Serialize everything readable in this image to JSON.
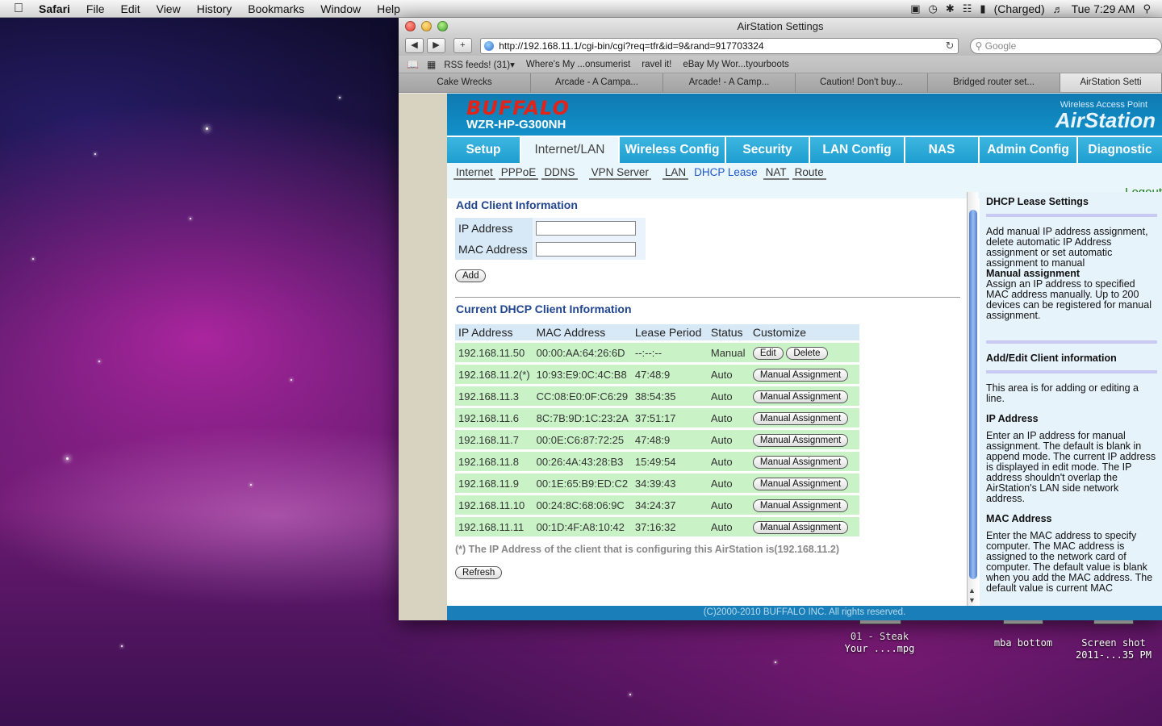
{
  "menubar": {
    "app": "Safari",
    "items": [
      "File",
      "Edit",
      "View",
      "History",
      "Bookmarks",
      "Window",
      "Help"
    ],
    "battery": "(Charged)",
    "clock": "Tue 7:29 AM"
  },
  "window": {
    "title": "AirStation Settings",
    "url": "http://192.168.11.1/cgi-bin/cgi?req=tfr&id=9&rand=917703324",
    "search_placeholder": "Google",
    "bookmarks": [
      "RSS feeds! (31)▾",
      "Where's My ...onsumerist",
      "ravel it!",
      "eBay My Wor...tyourboots"
    ],
    "tabs": [
      "Cake Wrecks",
      "Arcade - A Campa...",
      "Arcade! - A Camp...",
      "Caution! Don't buy...",
      "Bridged router set...",
      "AirStation Setti"
    ]
  },
  "router": {
    "brand": "BUFFALO",
    "model": "WZR-HP-G300NH",
    "ap_label": "Wireless Access Point",
    "ap_brand": "AirStation",
    "nav": [
      "Setup",
      "Internet/LAN",
      "Wireless Config",
      "Security",
      "LAN Config",
      "NAS",
      "Admin Config",
      "Diagnostic"
    ],
    "subnav": [
      "Internet",
      "PPPoE",
      "DDNS",
      "VPN Server",
      "LAN",
      "DHCP Lease",
      "NAT",
      "Route"
    ],
    "logout": "Logout",
    "add": {
      "title": "Add Client Information",
      "ip_label": "IP Address",
      "mac_label": "MAC Address",
      "ip_value": "",
      "mac_value": "",
      "add_button": "Add"
    },
    "current": {
      "title": "Current DHCP Client Information",
      "headers": [
        "IP Address",
        "MAC Address",
        "Lease Period",
        "Status",
        "Customize"
      ],
      "rows": [
        {
          "ip": "192.168.11.50",
          "mac": "00:00:AA:64:26:6D",
          "lease": "--:--:--",
          "status": "Manual"
        },
        {
          "ip": "192.168.11.2(*)",
          "mac": "10:93:E9:0C:4C:B8",
          "lease": "47:48:9",
          "status": "Auto"
        },
        {
          "ip": "192.168.11.3",
          "mac": "CC:08:E0:0F:C6:29",
          "lease": "38:54:35",
          "status": "Auto"
        },
        {
          "ip": "192.168.11.6",
          "mac": "8C:7B:9D:1C:23:2A",
          "lease": "37:51:17",
          "status": "Auto"
        },
        {
          "ip": "192.168.11.7",
          "mac": "00:0E:C6:87:72:25",
          "lease": "47:48:9",
          "status": "Auto"
        },
        {
          "ip": "192.168.11.8",
          "mac": "00:26:4A:43:28:B3",
          "lease": "15:49:54",
          "status": "Auto"
        },
        {
          "ip": "192.168.11.9",
          "mac": "00:1E:65:B9:ED:C2",
          "lease": "34:39:43",
          "status": "Auto"
        },
        {
          "ip": "192.168.11.10",
          "mac": "00:24:8C:68:06:9C",
          "lease": "34:24:37",
          "status": "Auto"
        },
        {
          "ip": "192.168.11.11",
          "mac": "00:1D:4F:A8:10:42",
          "lease": "37:16:32",
          "status": "Auto"
        }
      ],
      "edit_button": "Edit",
      "delete_button": "Delete",
      "manual_button": "Manual Assignment",
      "note": "(*) The IP Address of the client that is configuring this AirStation is(192.168.11.2)",
      "refresh_button": "Refresh"
    },
    "help": {
      "h1": "DHCP Lease Settings",
      "p1": "Add manual IP address assignment, delete automatic IP Address assignment or set automatic assignment to manual",
      "p1_bold": "Manual assignment",
      "p1_tail": "Assign an IP address to specified MAC address manually. Up to 200 devices can be registered for manual assignment.",
      "h2": "Add/Edit Client information",
      "p2": "This area is for adding or editing a line.",
      "h3": "IP Address",
      "p3": "Enter an IP address for manual assignment. The default is blank in append mode. The current IP address is displayed in edit mode. The IP address shouldn't overlap the AirStation's LAN side network address.",
      "h4": "MAC Address",
      "p4": "Enter the MAC address to specify computer. The MAC address is assigned to the network card of computer. The default value is blank when you add the MAC address. The default value is current MAC"
    },
    "footer": "(C)2000-2010 BUFFALO INC. All rights reserved."
  },
  "desktop": {
    "icons": [
      {
        "label1": "01 - Steak",
        "label2": "Your ....mpg"
      },
      {
        "label1": "mba bottom",
        "label2": ""
      },
      {
        "label1": "Screen shot",
        "label2": "2011-...35 PM"
      }
    ]
  }
}
